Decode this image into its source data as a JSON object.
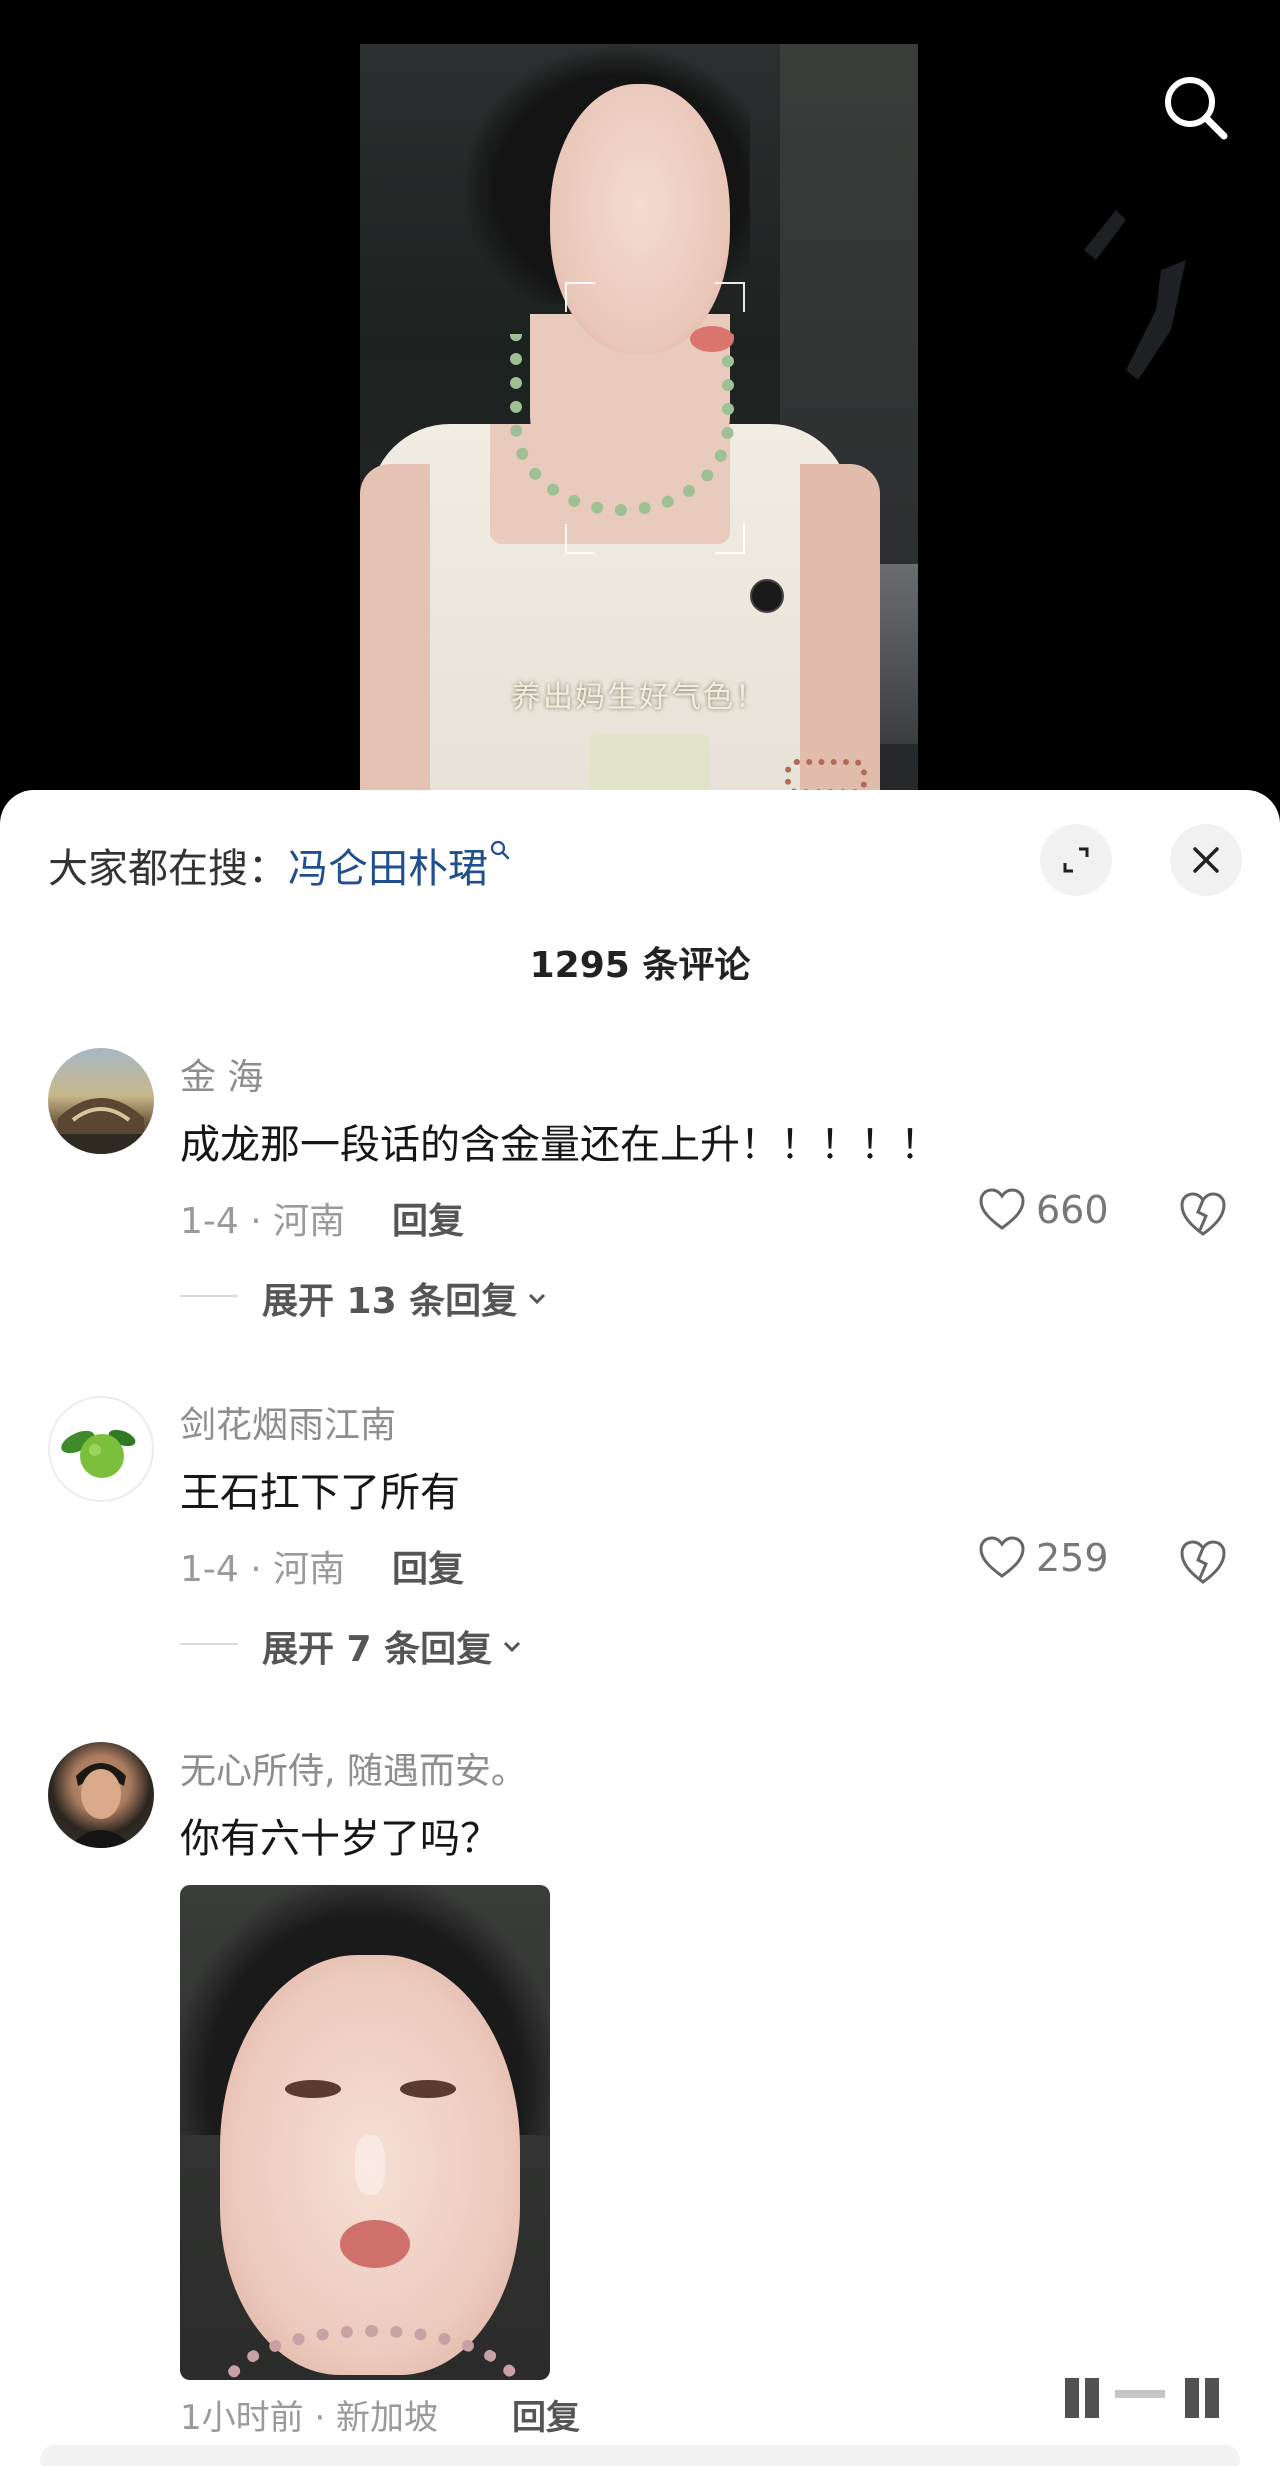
{
  "video": {
    "caption": "养出妈生好气色！"
  },
  "sheet": {
    "hot_search_prefix": "大家都在搜：",
    "hot_search_keyword": "冯仑田朴珺",
    "comment_count": "1295 条评论"
  },
  "comments": [
    {
      "name": "金 海",
      "text": "成龙那一段话的含金量还在上升！！！！！",
      "meta": "1-4 · 河南",
      "reply": "回复",
      "likes": "660",
      "expand": "展开 13 条回复"
    },
    {
      "name": "剑花烟雨江南",
      "text": "王石扛下了所有",
      "meta": "1-4 · 河南",
      "reply": "回复",
      "likes": "259",
      "expand": "展开 7 条回复"
    },
    {
      "name": "无心所侍, 随遇而安。",
      "text": "你有六十岁了吗？",
      "meta": "1小时前 · 新加坡",
      "reply": "回复"
    }
  ],
  "icons": {
    "search": "search-icon",
    "expand": "expand-icon",
    "close": "close-icon",
    "like": "heart-icon",
    "dislike": "broken-heart-icon",
    "chevron": "chevron-down-icon"
  },
  "colors": {
    "keyword": "#1f4f8f",
    "sheet_bg": "#ffffff",
    "video_bg": "#000000"
  }
}
